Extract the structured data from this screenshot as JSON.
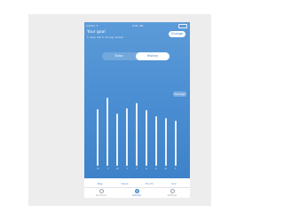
{
  "status": {
    "carrier": "Carrier ✦",
    "time": "9:41 AM"
  },
  "header": {
    "title": "Your goal",
    "subtitle": "5 days left in 30-day streak",
    "change_label": "Change"
  },
  "toggle": {
    "left": "Today",
    "right": "History"
  },
  "marker_label": "Average",
  "chart_data": {
    "type": "bar",
    "categories": [
      "M",
      "T",
      "W",
      "T",
      "F",
      "S",
      "S",
      "M",
      "T"
    ],
    "values": [
      62,
      75,
      58,
      63,
      69,
      61,
      55,
      53,
      50
    ],
    "ylim": [
      0,
      80
    ]
  },
  "ranges": [
    "Day",
    "Week",
    "Month",
    "Year"
  ],
  "active_range": "Day",
  "tabs": [
    {
      "label": "Summary",
      "icon": "clock-icon"
    },
    {
      "label": "Activity",
      "icon": "circle-icon"
    },
    {
      "label": "Settings",
      "icon": "gear-icon"
    }
  ],
  "colors": {
    "accent": "#3e82c9",
    "screen_top": "#5c9bd8",
    "screen_bottom": "#3e82c9"
  }
}
